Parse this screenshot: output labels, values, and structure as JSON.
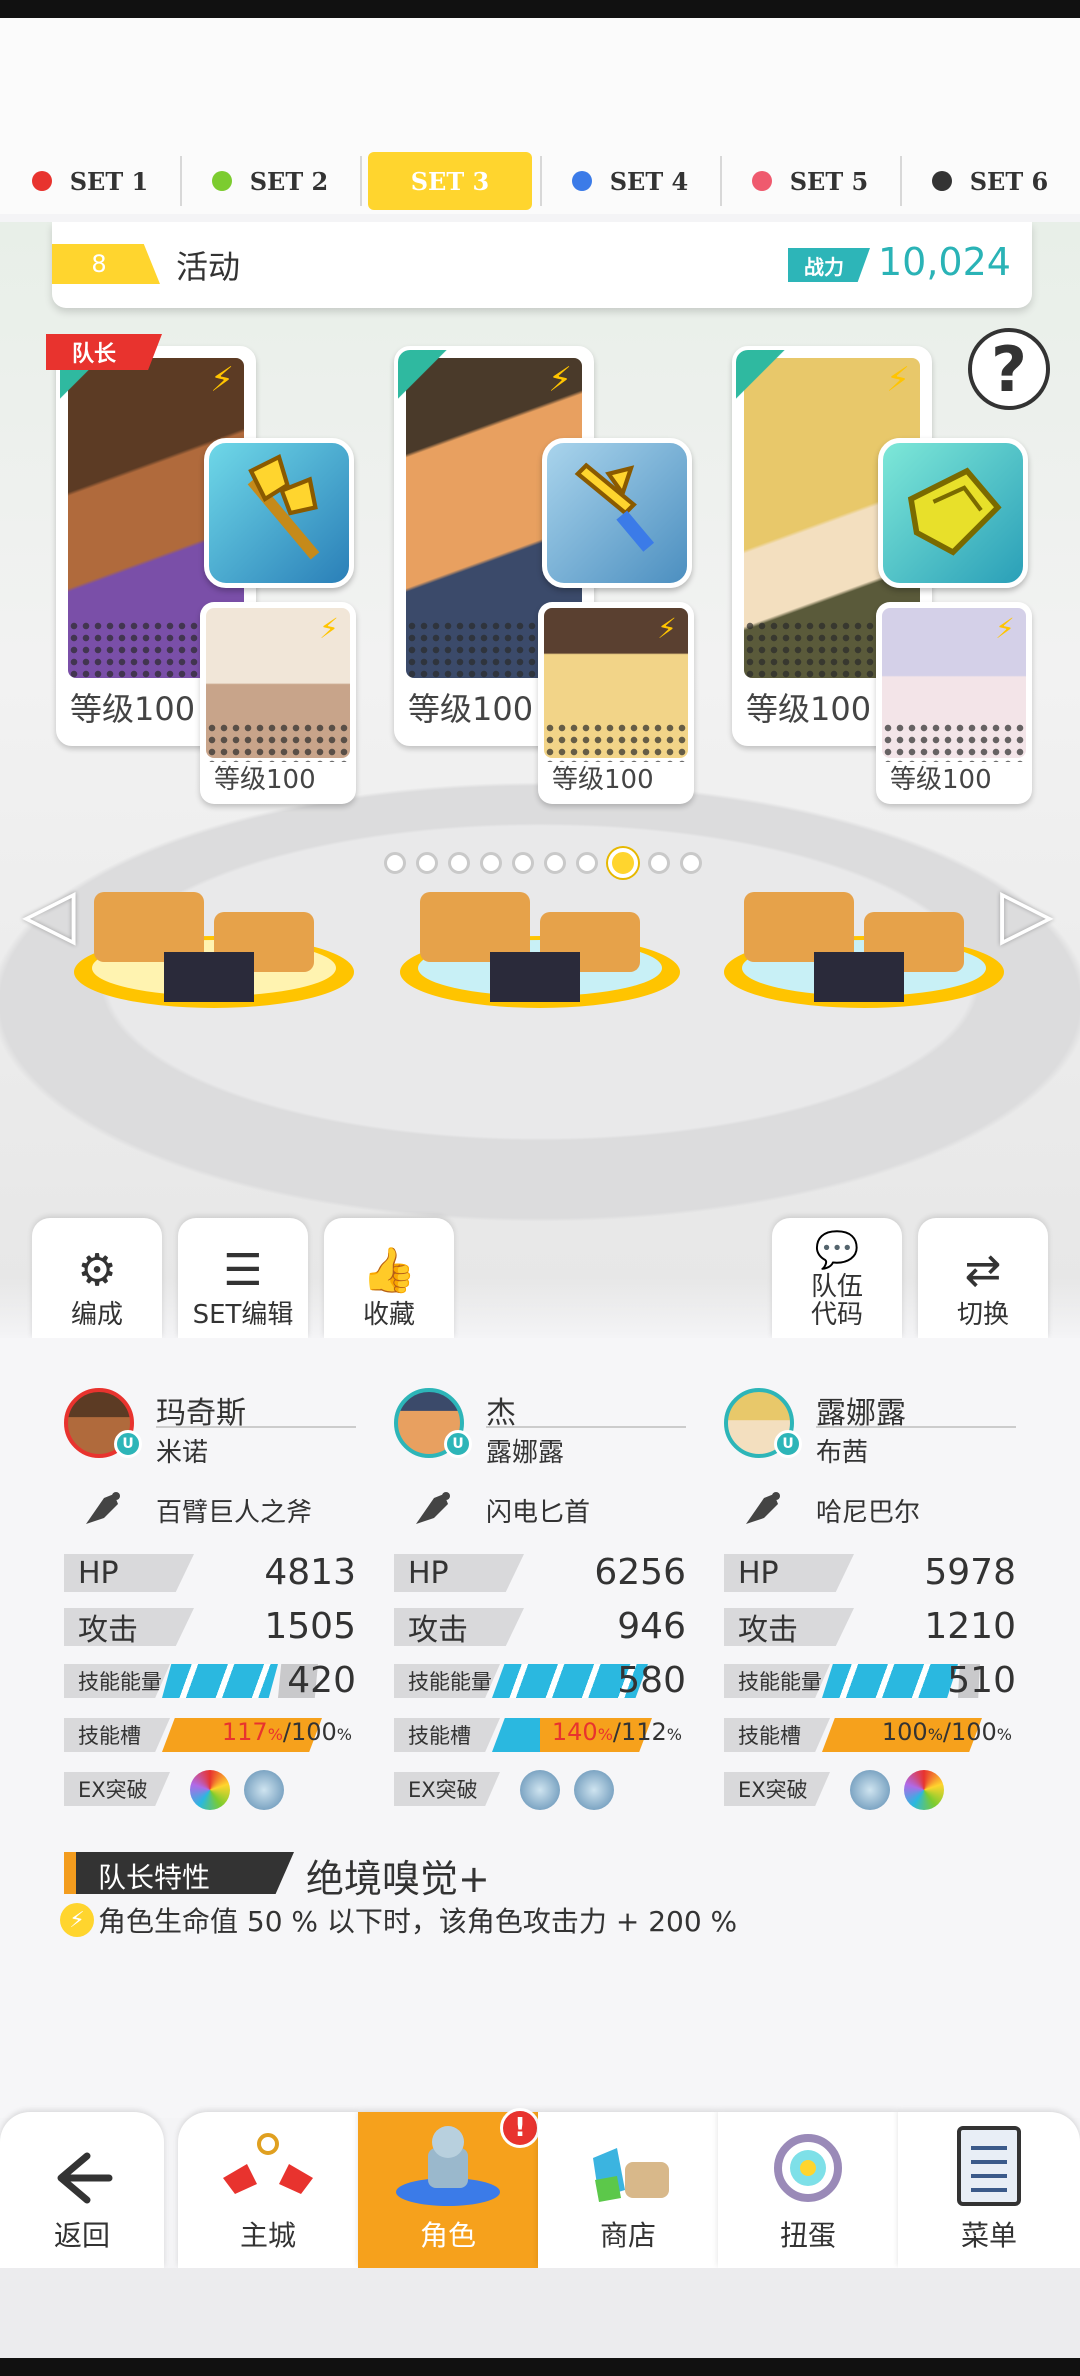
{
  "set_tabs": [
    {
      "label": "SET 1",
      "color": "#e8332e"
    },
    {
      "label": "SET 2",
      "color": "#7ccc2f"
    },
    {
      "label": "SET 3",
      "color": "#ffd52e"
    },
    {
      "label": "SET 4",
      "color": "#3b7be8"
    },
    {
      "label": "SET 5",
      "color": "#ef5a6e"
    },
    {
      "label": "SET 6",
      "color": "#333333"
    }
  ],
  "team": {
    "number": "8",
    "name": "活动",
    "power_label": "战力",
    "power_value": "10,024"
  },
  "leader_tag": "队长",
  "help_icon": "?",
  "members": [
    {
      "level": "等级100",
      "sub_level": "等级100"
    },
    {
      "level": "等级100",
      "sub_level": "等级100"
    },
    {
      "level": "等级100",
      "sub_level": "等级100"
    }
  ],
  "page_dots": {
    "count": 10,
    "active_index": 7
  },
  "actions": {
    "formation": "编成",
    "set_edit": "SET编辑",
    "favorites": "收藏",
    "team_code": "队伍\n代码",
    "switch": "切换"
  },
  "heroes": [
    {
      "name": "玛奇斯",
      "sub": "米诺",
      "weapon": "百臂巨人之斧",
      "hp_label": "HP",
      "hp": "4813",
      "atk_label": "攻击",
      "atk": "1505",
      "skill_energy_label": "技能能量",
      "skill_energy": "420",
      "skill_slot_label": "技能槽",
      "slot_current": "117",
      "slot_max": "/100",
      "ex_label": "EX突破"
    },
    {
      "name": "杰",
      "sub": "露娜露",
      "weapon": "闪电匕首",
      "hp_label": "HP",
      "hp": "6256",
      "atk_label": "攻击",
      "atk": "946",
      "skill_energy_label": "技能能量",
      "skill_energy": "580",
      "skill_slot_label": "技能槽",
      "slot_current": "140",
      "slot_max": "/112",
      "ex_label": "EX突破"
    },
    {
      "name": "露娜露",
      "sub": "布茜",
      "weapon": "哈尼巴尔",
      "hp_label": "HP",
      "hp": "5978",
      "atk_label": "攻击",
      "atk": "1210",
      "skill_energy_label": "技能能量",
      "skill_energy": "510",
      "skill_slot_label": "技能槽",
      "slot_current": "100",
      "slot_max": "/100",
      "ex_label": "EX突破"
    }
  ],
  "leader_skill": {
    "label": "队长特性",
    "name": "绝境嗅觉+",
    "description": "角色生命值 50 % 以下时，该角色攻击力 + 200 %"
  },
  "nav": {
    "back": "返回",
    "town": "主城",
    "character": "角色",
    "shop": "商店",
    "gacha": "扭蛋",
    "menu": "菜单",
    "character_badge": "!"
  }
}
